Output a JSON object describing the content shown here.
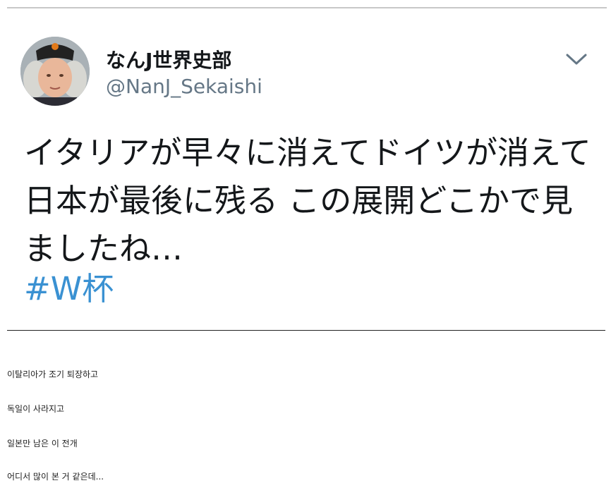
{
  "tweet": {
    "display_name": "なんJ世界史部",
    "handle": "@NanJ_Sekaishi",
    "text": "イタリアが早々に消えてドイツが消えて日本が最後に残る この展開どこかで見ましたね…",
    "hashtag": "#W杯",
    "menu_icon": "chevron-down-icon",
    "hashtag_color": "#3a91d2"
  },
  "captions": [
    "이탈리아가 조기 퇴장하고",
    "독일이 사라지고",
    "일본만 남은 이 전개",
    "어디서 많이 본 거 같은데..."
  ]
}
